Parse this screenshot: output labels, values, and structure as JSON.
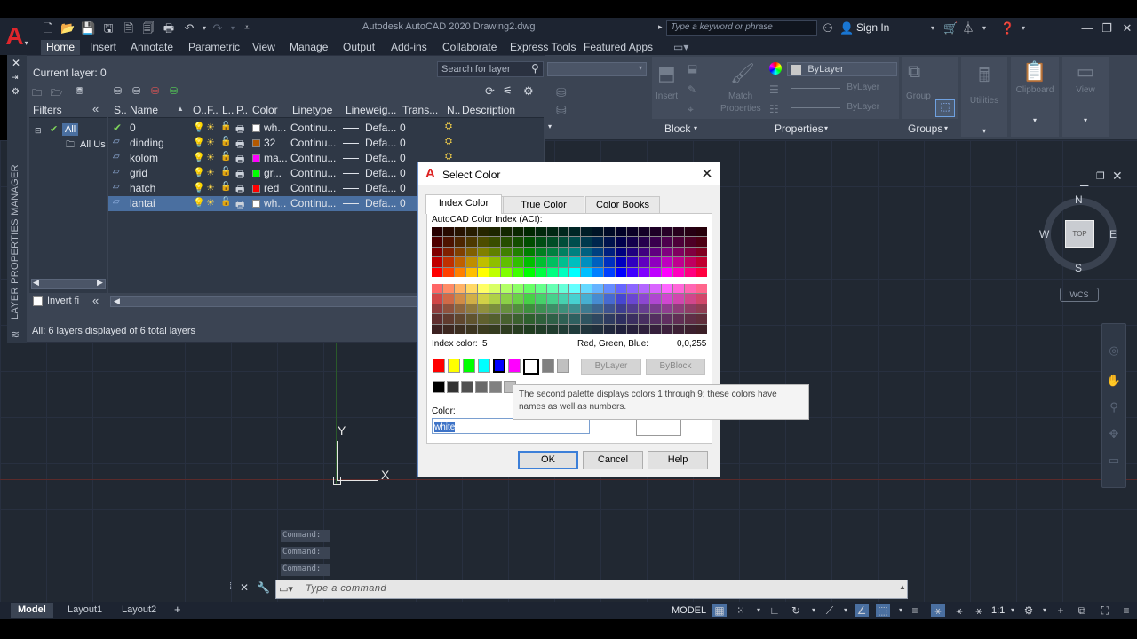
{
  "app": {
    "title": "Autodesk AutoCAD 2020   Drawing2.dwg",
    "search_placeholder": "Type a keyword or phrase",
    "sign_in": "Sign In"
  },
  "ribbon": {
    "tabs": [
      "Home",
      "Insert",
      "Annotate",
      "Parametric",
      "View",
      "Manage",
      "Output",
      "Add-ins",
      "Collaborate",
      "Express Tools",
      "Featured Apps"
    ],
    "active_tab": "Home",
    "panels": {
      "block": "Block",
      "properties": "Properties",
      "groups": "Groups",
      "insert_label": "Insert",
      "match_label": "Match",
      "match_label2": "Properties",
      "bylayer1": "ByLayer",
      "bylayer2": "ByLayer",
      "bylayer3": "ByLayer",
      "group_label": "Group",
      "utilities": "Utilities",
      "clipboard": "Clipboard",
      "view": "View"
    }
  },
  "layer_manager": {
    "current_layer": "Current layer: 0",
    "search_placeholder": "Search for layer",
    "filters_header": "Filters",
    "tree_all": "All",
    "tree_used": "All Us",
    "invert_filter": "Invert fi",
    "vertical_title": "LAYER PROPERTIES MANAGER",
    "status": "All: 6 layers displayed of 6 total layers",
    "columns": [
      "S..",
      "Name",
      "O..",
      "F..",
      "L..",
      "P..",
      "Color",
      "Linetype",
      "Lineweig...",
      "Trans...",
      "N..",
      "Description"
    ],
    "layers": [
      {
        "name": "0",
        "color_name": "wh...",
        "color_hex": "#ffffff",
        "linetype": "Continu...",
        "lineweight": "Defa...",
        "transparency": "0",
        "current": true,
        "selected": false
      },
      {
        "name": "dinding",
        "color_name": "32",
        "color_hex": "#b35900",
        "linetype": "Continu...",
        "lineweight": "Defa...",
        "transparency": "0",
        "current": false,
        "selected": false
      },
      {
        "name": "kolom",
        "color_name": "ma...",
        "color_hex": "#ff00ff",
        "linetype": "Continu...",
        "lineweight": "Defa...",
        "transparency": "0",
        "current": false,
        "selected": false
      },
      {
        "name": "grid",
        "color_name": "gr...",
        "color_hex": "#00ff00",
        "linetype": "Continu...",
        "lineweight": "Defa...",
        "transparency": "0",
        "current": false,
        "selected": false
      },
      {
        "name": "hatch",
        "color_name": "red",
        "color_hex": "#ff0000",
        "linetype": "Continu...",
        "lineweight": "Defa...",
        "transparency": "0",
        "current": false,
        "selected": false
      },
      {
        "name": "lantai",
        "color_name": "wh...",
        "color_hex": "#ffffff",
        "linetype": "Continu...",
        "lineweight": "Defa...",
        "transparency": "0",
        "current": false,
        "selected": true
      }
    ]
  },
  "dialog": {
    "title": "Select Color",
    "tabs": [
      "Index Color",
      "True Color",
      "Color Books"
    ],
    "active_tab": "Index Color",
    "aci_label": "AutoCAD Color Index (ACI):",
    "index_color_label": "Index color:",
    "index_color_value": "5",
    "rgb_label": "Red, Green, Blue:",
    "rgb_value": "0,0,255",
    "bylayer": "ByLayer",
    "byblock": "ByBlock",
    "color_label": "Color:",
    "color_value": "white",
    "tooltip": "The second palette displays colors 1 through 9; these colors have names as well as numbers.",
    "ok": "OK",
    "cancel": "Cancel",
    "help": "Help",
    "standard_colors": [
      "#ff0000",
      "#ffff00",
      "#00ff00",
      "#00ffff",
      "#0000ff",
      "#ff00ff",
      "#ffffff",
      "#808080",
      "#c0c0c0"
    ],
    "gray_colors": [
      "#000000",
      "#333333",
      "#505050",
      "#696969",
      "#808080",
      "#bebebe"
    ]
  },
  "viewcube": {
    "top": "TOP",
    "n": "N",
    "s": "S",
    "e": "E",
    "w": "W",
    "wcs": "WCS"
  },
  "ucs": {
    "x": "X",
    "y": "Y"
  },
  "command": {
    "history": [
      "Command:",
      "Command:",
      "Command:"
    ],
    "placeholder": "Type a command"
  },
  "status_bar": {
    "layouts": [
      "Model",
      "Layout1",
      "Layout2"
    ],
    "active_layout": "Model",
    "model": "MODEL",
    "scale": "1:1"
  }
}
